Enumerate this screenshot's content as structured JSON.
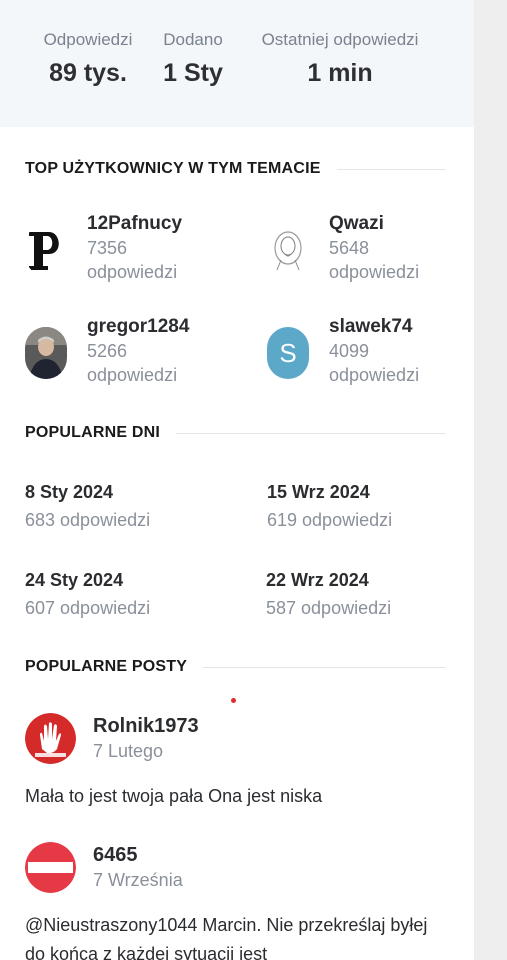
{
  "stats": [
    {
      "label": "Odpowiedzi",
      "value": "89 tys."
    },
    {
      "label": "Dodano",
      "value": "1 Sty"
    },
    {
      "label": "Ostatniej odpowiedzi",
      "value": "1 min"
    }
  ],
  "top_users": {
    "title": "TOP UŻYTKOWNICY W TYM TEMACIE",
    "users": [
      {
        "name": "12Pafnucy",
        "count": "7356",
        "unit": "odpowiedzi"
      },
      {
        "name": "Qwazi",
        "count": "5648",
        "unit": "odpowiedzi"
      },
      {
        "name": "gregor1284",
        "count": "5266",
        "unit": "odpowiedzi"
      },
      {
        "name": "slawek74",
        "count": "4099",
        "unit": "odpowiedzi",
        "avatar_letter": "S"
      }
    ]
  },
  "popular_days": {
    "title": "POPULARNE DNI",
    "days": [
      {
        "date": "8 Sty 2024",
        "count": "683 odpowiedzi"
      },
      {
        "date": "15 Wrz 2024",
        "count": "619 odpowiedzi"
      },
      {
        "date": "24 Sty 2024",
        "count": "607 odpowiedzi"
      },
      {
        "date": "22 Wrz 2024",
        "count": "587 odpowiedzi"
      }
    ]
  },
  "popular_posts": {
    "title": "POPULARNE POSTY",
    "posts": [
      {
        "author": "Rolnik1973",
        "date": "7 Lutego",
        "text": "Mała to jest twoja pała Ona jest niska"
      },
      {
        "author": "6465",
        "date": "7 Września",
        "text": "@Nieustraszony1044 Marcin. Nie przekreślaj byłej do końca z każdej sytuacji jest"
      }
    ]
  },
  "colors": {
    "stats_bg": "#f4f7fa",
    "gutter": "#eeeeee",
    "slawek_avatar": "#5ba8c9",
    "rolnik_avatar": "#d42a2a",
    "avatar_6465": "#e63946"
  }
}
